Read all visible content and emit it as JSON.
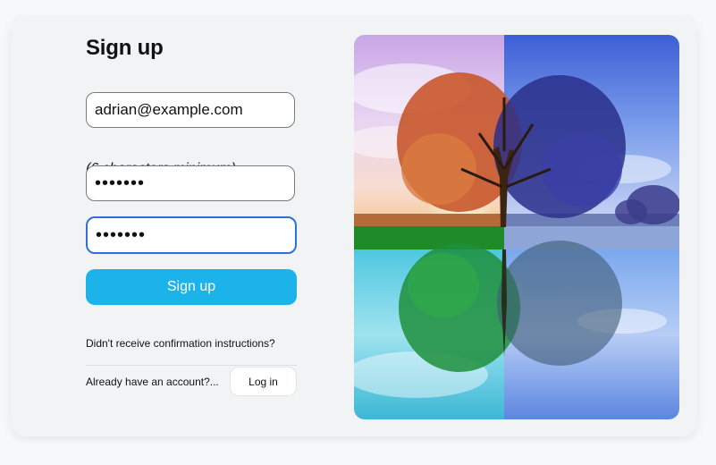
{
  "form": {
    "title": "Sign up",
    "email_value": "adrian@example.com",
    "password_hint": "(6 characters minimum)",
    "password_value": "•••••••",
    "password_confirmation_value": "•••••••",
    "submit_label": "Sign up",
    "confirmation_link": "Didn't receive confirmation instructions?",
    "login_prompt": "Already have an account?...",
    "login_label": "Log in"
  },
  "colors": {
    "page_background": "#f7f8f9",
    "card_background": "#f2f3f5",
    "primary_button": "#1cb3ea",
    "focus_border": "#2f6fd8"
  },
  "hero_image": {
    "subject": "four-seasons-tree-reflection"
  }
}
